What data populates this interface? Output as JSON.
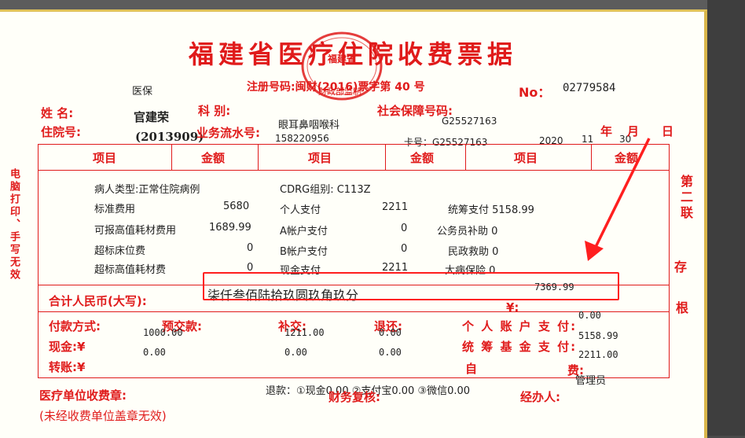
{
  "title": "福建省医疗住院收费票据",
  "insurance_tag": "医保",
  "register_no": "注册号码:闽财(2016)票字第 40 号",
  "no_label": "No：",
  "no_value": "02779584",
  "stamp": {
    "line1": "福建省",
    "line2": "财政部监制"
  },
  "name_label": "姓  名:",
  "name_value": "官建荣",
  "dept_label": "科  别:",
  "dept_value": "眼耳鼻咽喉科",
  "insurance_no_label": "社会保障号码:",
  "insurance_no_value": "G25527163",
  "admission_label": "住院号:",
  "admission_value": "(2013909)",
  "serial_label": "业务流水号:",
  "serial_value": "158220956",
  "card_no": "卡号：G25527163",
  "year_value": "2020",
  "month_value": "11",
  "day_value": "30",
  "year_label": "年",
  "month_label": "月",
  "day_label": "日",
  "col_item": "项目",
  "col_amount": "金额",
  "detail": {
    "patient_type": "病人类型:正常住院病例",
    "cdrg": "CDRG组别:  C113Z",
    "std_fee_label": "标准费用",
    "std_fee_value": "5680",
    "personal_pay_label": "个人支付",
    "personal_pay_value": "2211",
    "pool_pay": "统筹支付 5158.99",
    "hvc_label": "可报高值耗材费用",
    "hvc_value": "1689.99",
    "acct_a_label": "A帐户支付",
    "acct_a_value": "0",
    "civil_servant": "公务员补助 0",
    "over_bed_label": "超标床位费",
    "over_bed_value": "0",
    "acct_b_label": "B帐户支付",
    "acct_b_value": "0",
    "civil_aid": "民政救助 0",
    "over_hvc_label": "超标高值耗材费",
    "over_hvc_value": "0",
    "cash_label": "现金支付",
    "cash_value": "2211",
    "serious_ins": "大病保险  0"
  },
  "total_label": "合计人民币(大写):",
  "total_words": "柒仟叁佰陆拾玖圆玖角玖分",
  "total_value": "7369.99",
  "yen": "¥:",
  "pay_method_label": "付款方式:",
  "prepay_label": "预交款:",
  "prepay_value": "1000.00",
  "supplement_label": "补交:",
  "supplement_value": "1211.00",
  "refund_label": "退还:",
  "refund_value": "0.00",
  "cash_label2": "现金:¥",
  "cash_value2": "0.00",
  "supplement_value2": "0.00",
  "refund_value2": "0.00",
  "transfer_label": "转账:¥",
  "personal_acct_label": "个 人 账 户 支 付:",
  "pool_fund_label": "统 筹 基 金 支 付:",
  "self_label": "自",
  "self_fee_label": "费:",
  "right_val1": "0.00",
  "right_val2": "5158.99",
  "right_val3": "2211.00",
  "admin": "管理员",
  "refund_line": "退款：①现金0.00    ②支付宝0.00    ③微信0.00",
  "finance_review": "财务复核:",
  "handler": "经办人:",
  "stamp_label": "医疗单位收费章:",
  "stamp_note": "(未经收费单位盖章无效)",
  "left_vertical": "电脑打印、手写无效",
  "right_v1": "第二联",
  "right_v2": "存",
  "right_v3": "根",
  "colors": {
    "red": "#e01b1b",
    "annotation": "#ff1f1f",
    "paper": "#fffff9"
  }
}
